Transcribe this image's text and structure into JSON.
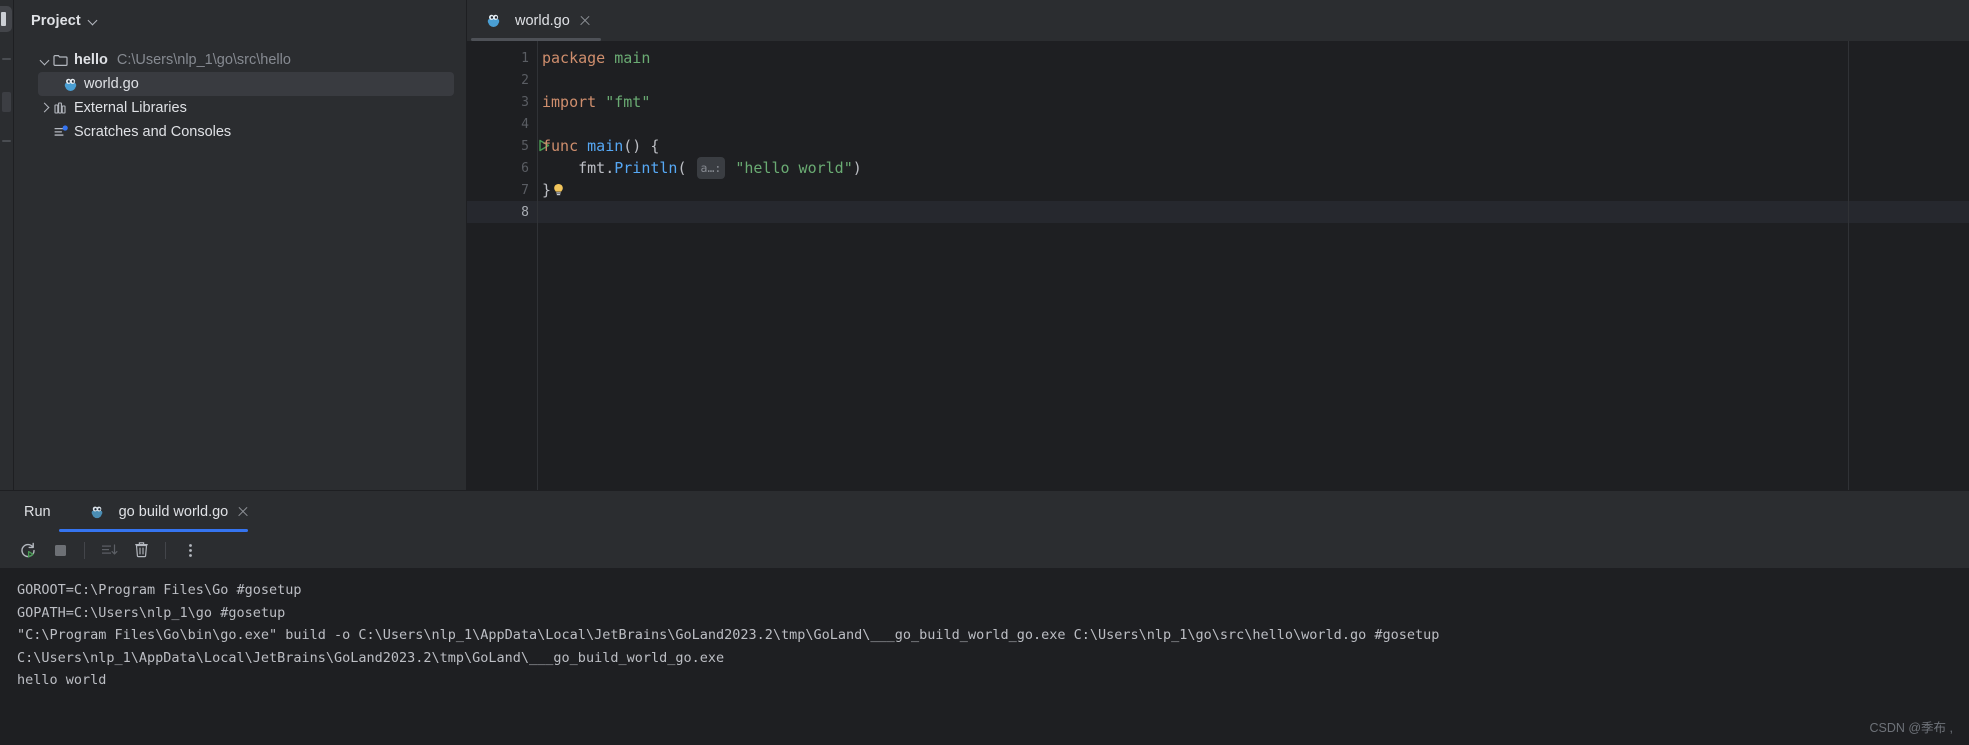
{
  "theme": {
    "bg_app": "#1e1f22",
    "bg_panel": "#2b2d30",
    "bg_selected": "#393b40",
    "accent_blue": "#3574f0",
    "text_primary": "#dfe1e5",
    "text_dim": "#868a91",
    "syntax_keyword": "#cf8e6d",
    "syntax_string": "#6aab73",
    "syntax_function": "#56a8f5",
    "run_green": "#499c54"
  },
  "sidebar": {
    "title": "Project",
    "collapse_icon": "chevron-down-icon",
    "tree": [
      {
        "label": "hello",
        "path": "C:\\Users\\nlp_1\\go\\src\\hello",
        "icon": "folder-icon",
        "arrow": "chevron-down-icon",
        "expanded": true,
        "selected": false,
        "indent": 0
      },
      {
        "label": "world.go",
        "path": "",
        "icon": "go-file-icon",
        "arrow": "",
        "expanded": false,
        "selected": true,
        "indent": 1
      },
      {
        "label": "External Libraries",
        "path": "",
        "icon": "library-icon",
        "arrow": "chevron-right-icon",
        "expanded": false,
        "selected": false,
        "indent": 0
      },
      {
        "label": "Scratches and Consoles",
        "path": "",
        "icon": "scratches-icon",
        "arrow": "",
        "expanded": false,
        "selected": false,
        "indent": 0
      }
    ]
  },
  "editor": {
    "tabs": [
      {
        "label": "world.go",
        "icon": "go-file-icon",
        "active": true,
        "close_icon": "close-icon"
      }
    ],
    "current_line": 8,
    "lines": [
      {
        "num": 1,
        "gutter_icon": "",
        "tokens": [
          {
            "t": "kw",
            "v": "package"
          },
          {
            "t": "pl",
            "v": " "
          },
          {
            "t": "str",
            "v": "main"
          }
        ]
      },
      {
        "num": 2,
        "gutter_icon": "",
        "tokens": []
      },
      {
        "num": 3,
        "gutter_icon": "",
        "tokens": [
          {
            "t": "kw",
            "v": "import"
          },
          {
            "t": "pl",
            "v": " "
          },
          {
            "t": "str",
            "v": "\"fmt\""
          }
        ]
      },
      {
        "num": 4,
        "gutter_icon": "",
        "tokens": []
      },
      {
        "num": 5,
        "gutter_icon": "run-gutter-icon",
        "tokens": [
          {
            "t": "kw",
            "v": "func"
          },
          {
            "t": "pl",
            "v": " "
          },
          {
            "t": "fn",
            "v": "main"
          },
          {
            "t": "pl",
            "v": "() {"
          }
        ]
      },
      {
        "num": 6,
        "gutter_icon": "",
        "tokens": [
          {
            "t": "pl",
            "v": "    fmt."
          },
          {
            "t": "fn",
            "v": "Println"
          },
          {
            "t": "pl",
            "v": "( "
          },
          {
            "t": "hint",
            "v": "a…:"
          },
          {
            "t": "pl",
            "v": " "
          },
          {
            "t": "str",
            "v": "\"hello world\""
          },
          {
            "t": "pl",
            "v": ")"
          }
        ]
      },
      {
        "num": 7,
        "gutter_icon": "",
        "tokens": [
          {
            "t": "pl",
            "v": "}"
          },
          {
            "t": "bulb",
            "v": ""
          }
        ]
      },
      {
        "num": 8,
        "gutter_icon": "",
        "tokens": []
      }
    ]
  },
  "run_panel": {
    "label": "Run",
    "tabs": [
      {
        "label": "go build world.go",
        "icon": "go-file-icon",
        "active": true,
        "close_icon": "close-icon"
      }
    ],
    "toolbar": [
      {
        "name": "rerun-button",
        "icon": "rerun-icon",
        "enabled": true
      },
      {
        "name": "stop-button",
        "icon": "stop-icon",
        "enabled": true
      },
      {
        "name": "scroll-to-end-button",
        "icon": "scroll-to-end-icon",
        "enabled": false
      },
      {
        "name": "clear-all-button",
        "icon": "trash-icon",
        "enabled": true
      },
      {
        "name": "more-options-button",
        "icon": "more-vertical-icon",
        "enabled": true
      }
    ],
    "console_lines": [
      "GOROOT=C:\\Program Files\\Go #gosetup",
      "GOPATH=C:\\Users\\nlp_1\\go #gosetup",
      "\"C:\\Program Files\\Go\\bin\\go.exe\" build -o C:\\Users\\nlp_1\\AppData\\Local\\JetBrains\\GoLand2023.2\\tmp\\GoLand\\___go_build_world_go.exe C:\\Users\\nlp_1\\go\\src\\hello\\world.go #gosetup",
      "C:\\Users\\nlp_1\\AppData\\Local\\JetBrains\\GoLand2023.2\\tmp\\GoLand\\___go_build_world_go.exe",
      "hello world"
    ]
  },
  "watermark": "CSDN @季布 ,"
}
